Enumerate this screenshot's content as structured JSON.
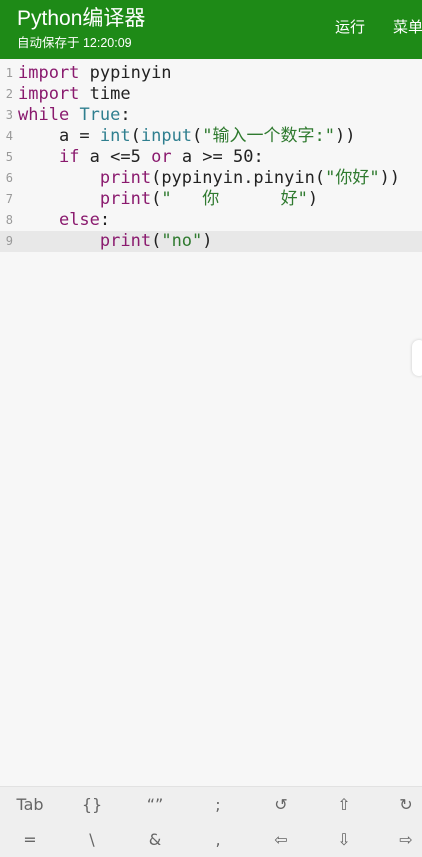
{
  "appbar": {
    "title": "Python编译器",
    "autosave": "自动保存于 12:20:09",
    "actions": {
      "run": "运行",
      "menu": "菜单"
    }
  },
  "editor": {
    "current_line": 9,
    "lines": [
      {
        "num": "1",
        "tokens": [
          {
            "t": "import",
            "c": "kw"
          },
          {
            "t": " pypinyin",
            "c": "plain"
          }
        ]
      },
      {
        "num": "2",
        "tokens": [
          {
            "t": "import",
            "c": "kw"
          },
          {
            "t": " time",
            "c": "plain"
          }
        ]
      },
      {
        "num": "3",
        "tokens": [
          {
            "t": "while",
            "c": "kw"
          },
          {
            "t": " ",
            "c": "plain"
          },
          {
            "t": "True",
            "c": "bi"
          },
          {
            "t": ":",
            "c": "plain"
          }
        ]
      },
      {
        "num": "4",
        "tokens": [
          {
            "t": "    a = ",
            "c": "plain"
          },
          {
            "t": "int",
            "c": "bi"
          },
          {
            "t": "(",
            "c": "plain"
          },
          {
            "t": "input",
            "c": "bi"
          },
          {
            "t": "(",
            "c": "plain"
          },
          {
            "t": "\"输入一个数字:\"",
            "c": "str"
          },
          {
            "t": "))",
            "c": "plain"
          }
        ]
      },
      {
        "num": "5",
        "tokens": [
          {
            "t": "    ",
            "c": "plain"
          },
          {
            "t": "if",
            "c": "kw"
          },
          {
            "t": " a <=5 ",
            "c": "plain"
          },
          {
            "t": "or",
            "c": "kw"
          },
          {
            "t": " a >= 50:",
            "c": "plain"
          }
        ]
      },
      {
        "num": "6",
        "tokens": [
          {
            "t": "        ",
            "c": "plain"
          },
          {
            "t": "print",
            "c": "kw"
          },
          {
            "t": "(pypinyin.pinyin(",
            "c": "plain"
          },
          {
            "t": "\"你好\"",
            "c": "str"
          },
          {
            "t": "))",
            "c": "plain"
          }
        ]
      },
      {
        "num": "7",
        "tokens": [
          {
            "t": "        ",
            "c": "plain"
          },
          {
            "t": "print",
            "c": "kw"
          },
          {
            "t": "(",
            "c": "plain"
          },
          {
            "t": "\"   你      好\"",
            "c": "str"
          },
          {
            "t": ")",
            "c": "plain"
          }
        ]
      },
      {
        "num": "8",
        "tokens": [
          {
            "t": "    ",
            "c": "plain"
          },
          {
            "t": "else",
            "c": "kw"
          },
          {
            "t": ":",
            "c": "plain"
          }
        ]
      },
      {
        "num": "9",
        "tokens": [
          {
            "t": "        ",
            "c": "plain"
          },
          {
            "t": "print",
            "c": "kw"
          },
          {
            "t": "(",
            "c": "plain"
          },
          {
            "t": "\"no\"",
            "c": "str"
          },
          {
            "t": ")",
            "c": "plain"
          }
        ]
      }
    ]
  },
  "keybar": {
    "row1": [
      {
        "label": "Tab",
        "name": "key-tab"
      },
      {
        "label": "{}",
        "name": "key-braces"
      },
      {
        "label": "“”",
        "name": "key-quotes"
      },
      {
        "label": ";",
        "name": "key-semicolon"
      },
      {
        "label": "↺",
        "name": "undo-icon"
      },
      {
        "label": "⇧",
        "name": "cursor-up-icon"
      },
      {
        "label": "↻",
        "name": "redo-icon"
      }
    ],
    "row2": [
      {
        "label": "=",
        "name": "key-equals"
      },
      {
        "label": "\\",
        "name": "key-backslash"
      },
      {
        "label": "&",
        "name": "key-ampersand"
      },
      {
        "label": ",",
        "name": "key-comma"
      },
      {
        "label": "⇦",
        "name": "cursor-left-icon"
      },
      {
        "label": "⇩",
        "name": "cursor-down-icon"
      },
      {
        "label": "⇨",
        "name": "cursor-right-icon"
      }
    ]
  },
  "colors": {
    "appbar": "#1e8a17",
    "keyword": "#8a1a6e",
    "builtin": "#2f7f8f",
    "string": "#2f7a2f"
  }
}
